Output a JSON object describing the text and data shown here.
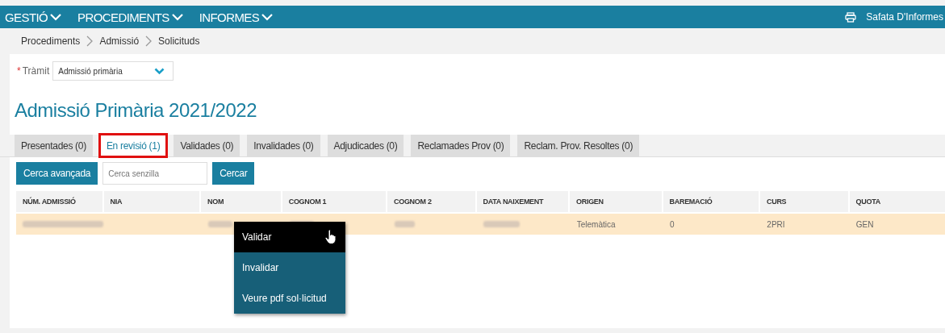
{
  "nav": {
    "menus": [
      {
        "label": "GESTIÓ"
      },
      {
        "label": "PROCEDIMENTS"
      },
      {
        "label": "INFORMES"
      }
    ],
    "tray": "Safata D'Informes"
  },
  "breadcrumb": [
    "Procediments",
    "Admissió",
    "Solicituds"
  ],
  "tramit": {
    "required_mark": "*",
    "label": "Tràmit",
    "value": "Admissió primària"
  },
  "title": "Admissió Primària 2021/2022",
  "tabs": [
    {
      "label": "Presentades (0)",
      "selected": false
    },
    {
      "label": "En revisió (1)",
      "selected": true
    },
    {
      "label": "Validades (0)",
      "selected": false
    },
    {
      "label": "Invalidades (0)",
      "selected": false
    },
    {
      "label": "Adjudicades (0)",
      "selected": false
    },
    {
      "label": "Reclamades Prov (0)",
      "selected": false
    },
    {
      "label": "Reclam. Prov. Resoltes (0)",
      "selected": false
    }
  ],
  "toolbar": {
    "advanced_search": "Cerca avançada",
    "search": {
      "placeholder": "Cerca senzilla"
    },
    "search_button": "Cercar"
  },
  "table": {
    "columns": [
      "NÚM. ADMISSIÓ",
      "NIA",
      "NOM",
      "COGNOM 1",
      "COGNOM 2",
      "DATA NAIXEMENT",
      "ORIGEN",
      "BAREMACIÓ",
      "CURS",
      "QUOTA"
    ],
    "rows": [
      {
        "selected": true,
        "cells": [
          {
            "kind": "blurred"
          },
          {
            "kind": "empty"
          },
          {
            "kind": "blurred"
          },
          {
            "kind": "blurred"
          },
          {
            "kind": "blurred"
          },
          {
            "kind": "blurred"
          },
          {
            "kind": "text",
            "text": "Telemàtica"
          },
          {
            "kind": "text",
            "text": "0"
          },
          {
            "kind": "text",
            "text": "2PRI"
          },
          {
            "kind": "text",
            "text": "GEN"
          }
        ]
      }
    ]
  },
  "context_menu": [
    {
      "label": "Validar",
      "selected": true
    },
    {
      "label": "Invalidar",
      "selected": false
    },
    {
      "label": "Veure pdf sol·licitud",
      "selected": false
    }
  ]
}
